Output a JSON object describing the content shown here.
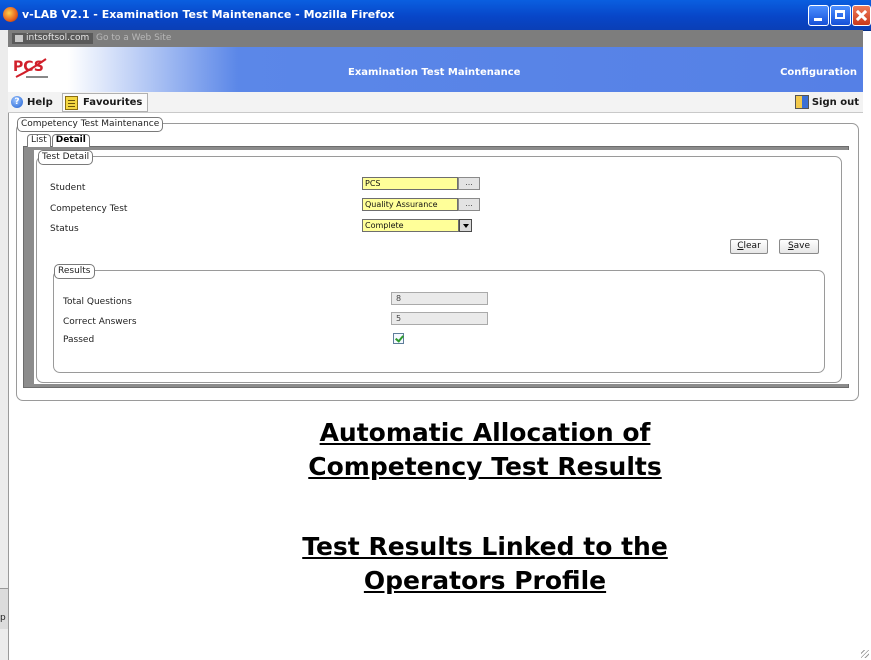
{
  "window": {
    "title": "v-LAB V2.1 - Examination Test Maintenance - Mozilla Firefox"
  },
  "address_bar": {
    "site_label": "intsoftsol.com",
    "go_text": "Go to a Web Site"
  },
  "header": {
    "logo_text": "PCS",
    "page_title": "Examination Test Maintenance",
    "menu_configuration": "Configuration"
  },
  "toolbar": {
    "help_label": "Help",
    "favourites_label": "Favourites",
    "signout_label": "Sign out"
  },
  "panel": {
    "legend": "Competency Test Maintenance",
    "tabs": [
      {
        "label": "List",
        "active": false
      },
      {
        "label": "Detail",
        "active": true
      }
    ],
    "detail": {
      "legend": "Test Detail",
      "fields": {
        "student_label": "Student",
        "student_value": "PCS",
        "competency_label": "Competency Test",
        "competency_value": "Quality Assurance",
        "status_label": "Status",
        "status_value": "Complete",
        "ellipsis": "..."
      },
      "buttons": {
        "clear_key": "C",
        "clear_rest": "lear",
        "save_key": "S",
        "save_rest": "ave"
      },
      "results": {
        "legend": "Results",
        "total_label": "Total Questions",
        "total_value": "8",
        "correct_label": "Correct Answers",
        "correct_value": "5",
        "passed_label": "Passed",
        "passed_checked": true
      }
    }
  },
  "overlay": {
    "heading1_line1": "Automatic Allocation of",
    "heading1_line2": "Competency Test Results",
    "heading2_line1": "Test Results Linked to the",
    "heading2_line2": "Operators Profile"
  },
  "edge_text": "p",
  "colors": {
    "titlebar": "#0846c8",
    "header_blue": "#5580e6",
    "input_yellow": "#ffff99"
  }
}
